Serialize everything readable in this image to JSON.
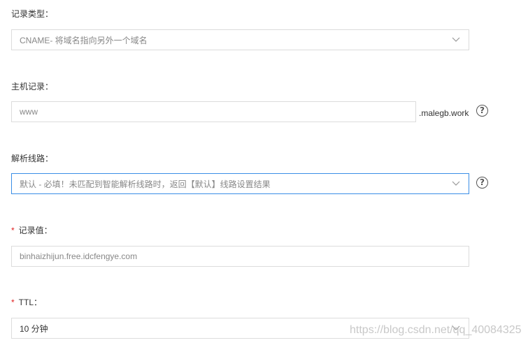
{
  "record_type": {
    "label": "记录类型：",
    "value": "CNAME- 将域名指向另外一个域名"
  },
  "host_record": {
    "label": "主机记录：",
    "value": "www",
    "suffix": ".malegb.work"
  },
  "resolution_line": {
    "label": "解析线路：",
    "value": "默认 - 必填！未匹配到智能解析线路时，返回【默认】线路设置结果"
  },
  "record_value": {
    "required_mark": "*",
    "label": "记录值：",
    "value": "binhaizhijun.free.idcfengye.com"
  },
  "ttl": {
    "required_mark": "*",
    "label": "TTL：",
    "value": "10 分钟"
  },
  "help_glyph": "?",
  "watermark": "https://blog.csdn.net/qq_40084325",
  "colors": {
    "border": "#dcdcdc",
    "active_border": "#3a8ee6",
    "required": "#e02020"
  },
  "icons": [
    "chevron-down-icon",
    "question-circle-icon"
  ]
}
